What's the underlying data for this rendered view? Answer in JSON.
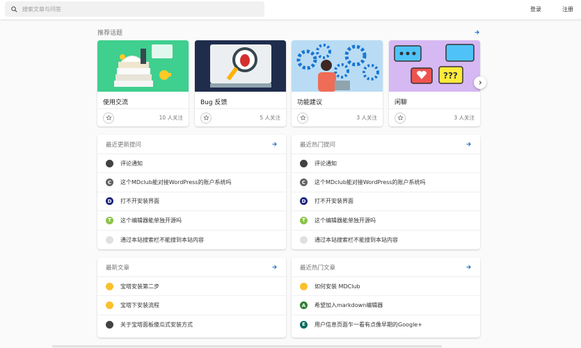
{
  "header": {
    "search_placeholder": "搜索文章与问答",
    "login": "登录",
    "register": "注册"
  },
  "topics": {
    "title": "推荐话题",
    "items": [
      {
        "name": "使用交流",
        "follow": "10 人关注"
      },
      {
        "name": "Bug 反馈",
        "follow": "5 人关注"
      },
      {
        "name": "功能建议",
        "follow": "3 人关注"
      },
      {
        "name": "闲聊",
        "follow": "3 人关注"
      }
    ]
  },
  "latest_questions": {
    "title": "最近更新提问",
    "items": [
      {
        "text": "评论通知",
        "avatar": "",
        "color": "#424242"
      },
      {
        "text": "这个MDclub能对接WordPress的账户系统吗",
        "avatar": "C",
        "color": "#616161"
      },
      {
        "text": "打不开安装界面",
        "avatar": "D",
        "color": "#1a237e"
      },
      {
        "text": "这个编辑器能单独开源吗",
        "avatar": "T",
        "color": "#8bc34a"
      },
      {
        "text": "通过本站搜索栏不能搜到本站内容",
        "avatar": "",
        "color": "#e0e0e0"
      }
    ]
  },
  "hot_questions": {
    "title": "最近热门提问",
    "items": [
      {
        "text": "评论通知",
        "avatar": "",
        "color": "#424242"
      },
      {
        "text": "这个MDclub能对接WordPress的账户系统吗",
        "avatar": "C",
        "color": "#616161"
      },
      {
        "text": "打不开安装界面",
        "avatar": "D",
        "color": "#1a237e"
      },
      {
        "text": "这个编辑器能单独开源吗",
        "avatar": "T",
        "color": "#8bc34a"
      },
      {
        "text": "通过本站搜索栏不能搜到本站内容",
        "avatar": "",
        "color": "#e0e0e0"
      }
    ]
  },
  "latest_articles": {
    "title": "最新文章",
    "items": [
      {
        "text": "宝塔安装第二步",
        "avatar": "",
        "color": "#fbc02d"
      },
      {
        "text": "宝塔下安装流程",
        "avatar": "",
        "color": "#fbc02d"
      },
      {
        "text": "关于宝塔面板傻瓜式安装方式",
        "avatar": "",
        "color": "#424242"
      }
    ]
  },
  "hot_articles": {
    "title": "最近热门文章",
    "items": [
      {
        "text": "如何安装 MDClub",
        "avatar": "",
        "color": "#fbc02d"
      },
      {
        "text": "希望加入markdown编辑器",
        "avatar": "A",
        "color": "#2e7d32"
      },
      {
        "text": "用户信息页面乍一看有点像早期的Google+",
        "avatar": "E",
        "color": "#00695c"
      }
    ]
  }
}
